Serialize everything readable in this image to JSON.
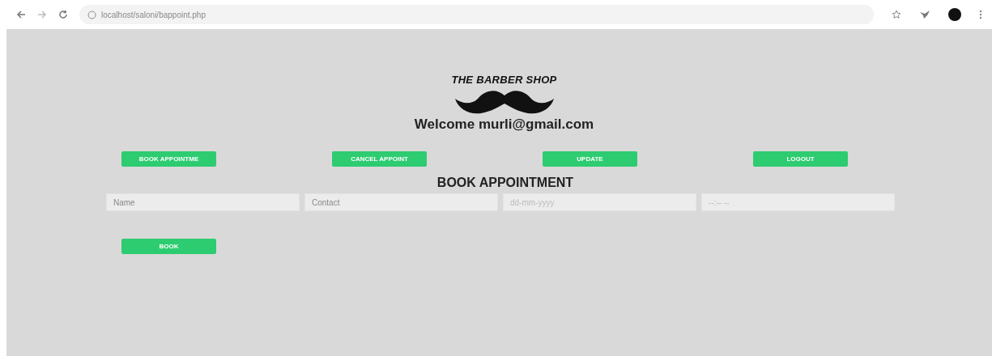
{
  "browser": {
    "url": "localhost/saloni/bappoint.php"
  },
  "header": {
    "title": "THE BARBER SHOP",
    "welcome": "Welcome murli@gmail.com"
  },
  "nav_buttons": [
    "BOOK APPOINTME",
    "CANCEL APPOINT",
    "UPDATE",
    "LOGOUT"
  ],
  "form": {
    "heading": "BOOK APPOINTMENT",
    "fields": [
      {
        "kind": "text",
        "placeholder": "Name"
      },
      {
        "kind": "text",
        "placeholder": "Contact"
      },
      {
        "kind": "date",
        "placeholder": "dd-mm-yyyy"
      },
      {
        "kind": "time",
        "placeholder": "--:-- --"
      }
    ],
    "submit": "BOOK"
  }
}
